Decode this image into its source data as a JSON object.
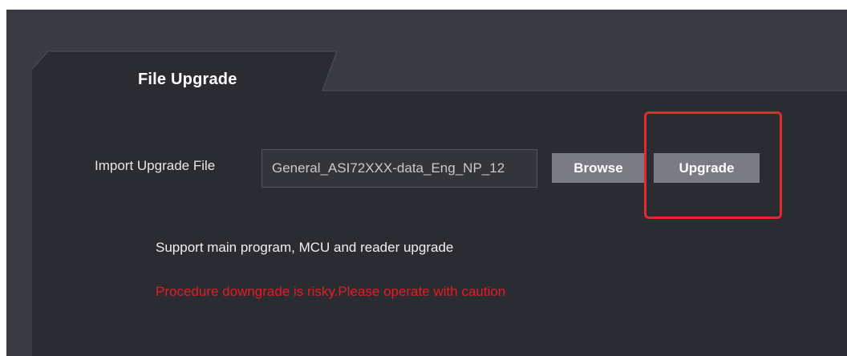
{
  "tab": {
    "label": "File Upgrade"
  },
  "import": {
    "label": "Import Upgrade File",
    "file_value": "General_ASI72XXX-data_Eng_NP_12",
    "browse_label": "Browse",
    "upgrade_label": "Upgrade"
  },
  "notes": {
    "support": "Support main program, MCU and reader upgrade",
    "warning": "Procedure downgrade is risky.Please operate with caution"
  },
  "colors": {
    "background": "#2b2c31",
    "tab_strip": "#3a3b41",
    "button": "#7b7c83",
    "highlight": "#e3282e",
    "warning": "#e11d24"
  }
}
